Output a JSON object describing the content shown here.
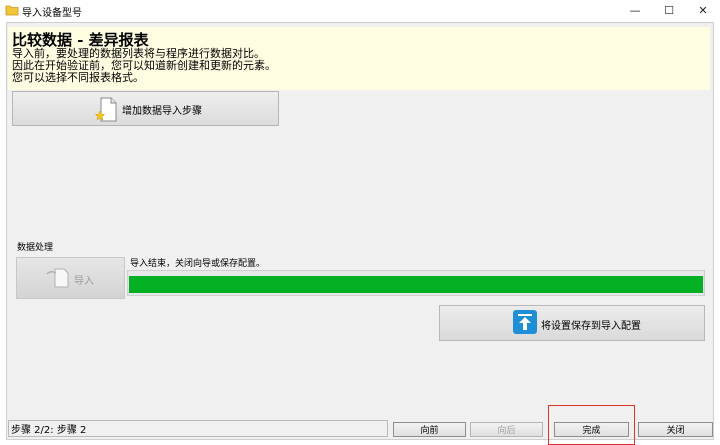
{
  "window": {
    "title": "导入设备型号",
    "minimize_glyph": "—",
    "maximize_glyph": "☐",
    "close_glyph": "✕"
  },
  "header": {
    "title": "比较数据 - 差异报表",
    "lines": [
      "导入前，要处理的数据列表将与程序进行数据对比。",
      "因此在开始验证前，您可以知道新创建和更新的元素。",
      "您可以选择不同报表格式。"
    ]
  },
  "add_step": {
    "label": "增加数据导入步骤"
  },
  "processing": {
    "section_label": "数据处理",
    "import_label": "导入",
    "status": "导入结束，关闭向导或保存配置。",
    "progress": 1.0
  },
  "save_config": {
    "label": "将设置保存到导入配置"
  },
  "statusbar": {
    "text": "步骤 2/2: 步骤 2"
  },
  "nav": {
    "prev": "向前",
    "next": "向后",
    "finish": "完成",
    "close": "关闭"
  },
  "colors": {
    "header_bg": "#fffde1",
    "progress": "#06b025",
    "highlight": "#d9352c",
    "upload_icon": "#1e8fd6"
  }
}
